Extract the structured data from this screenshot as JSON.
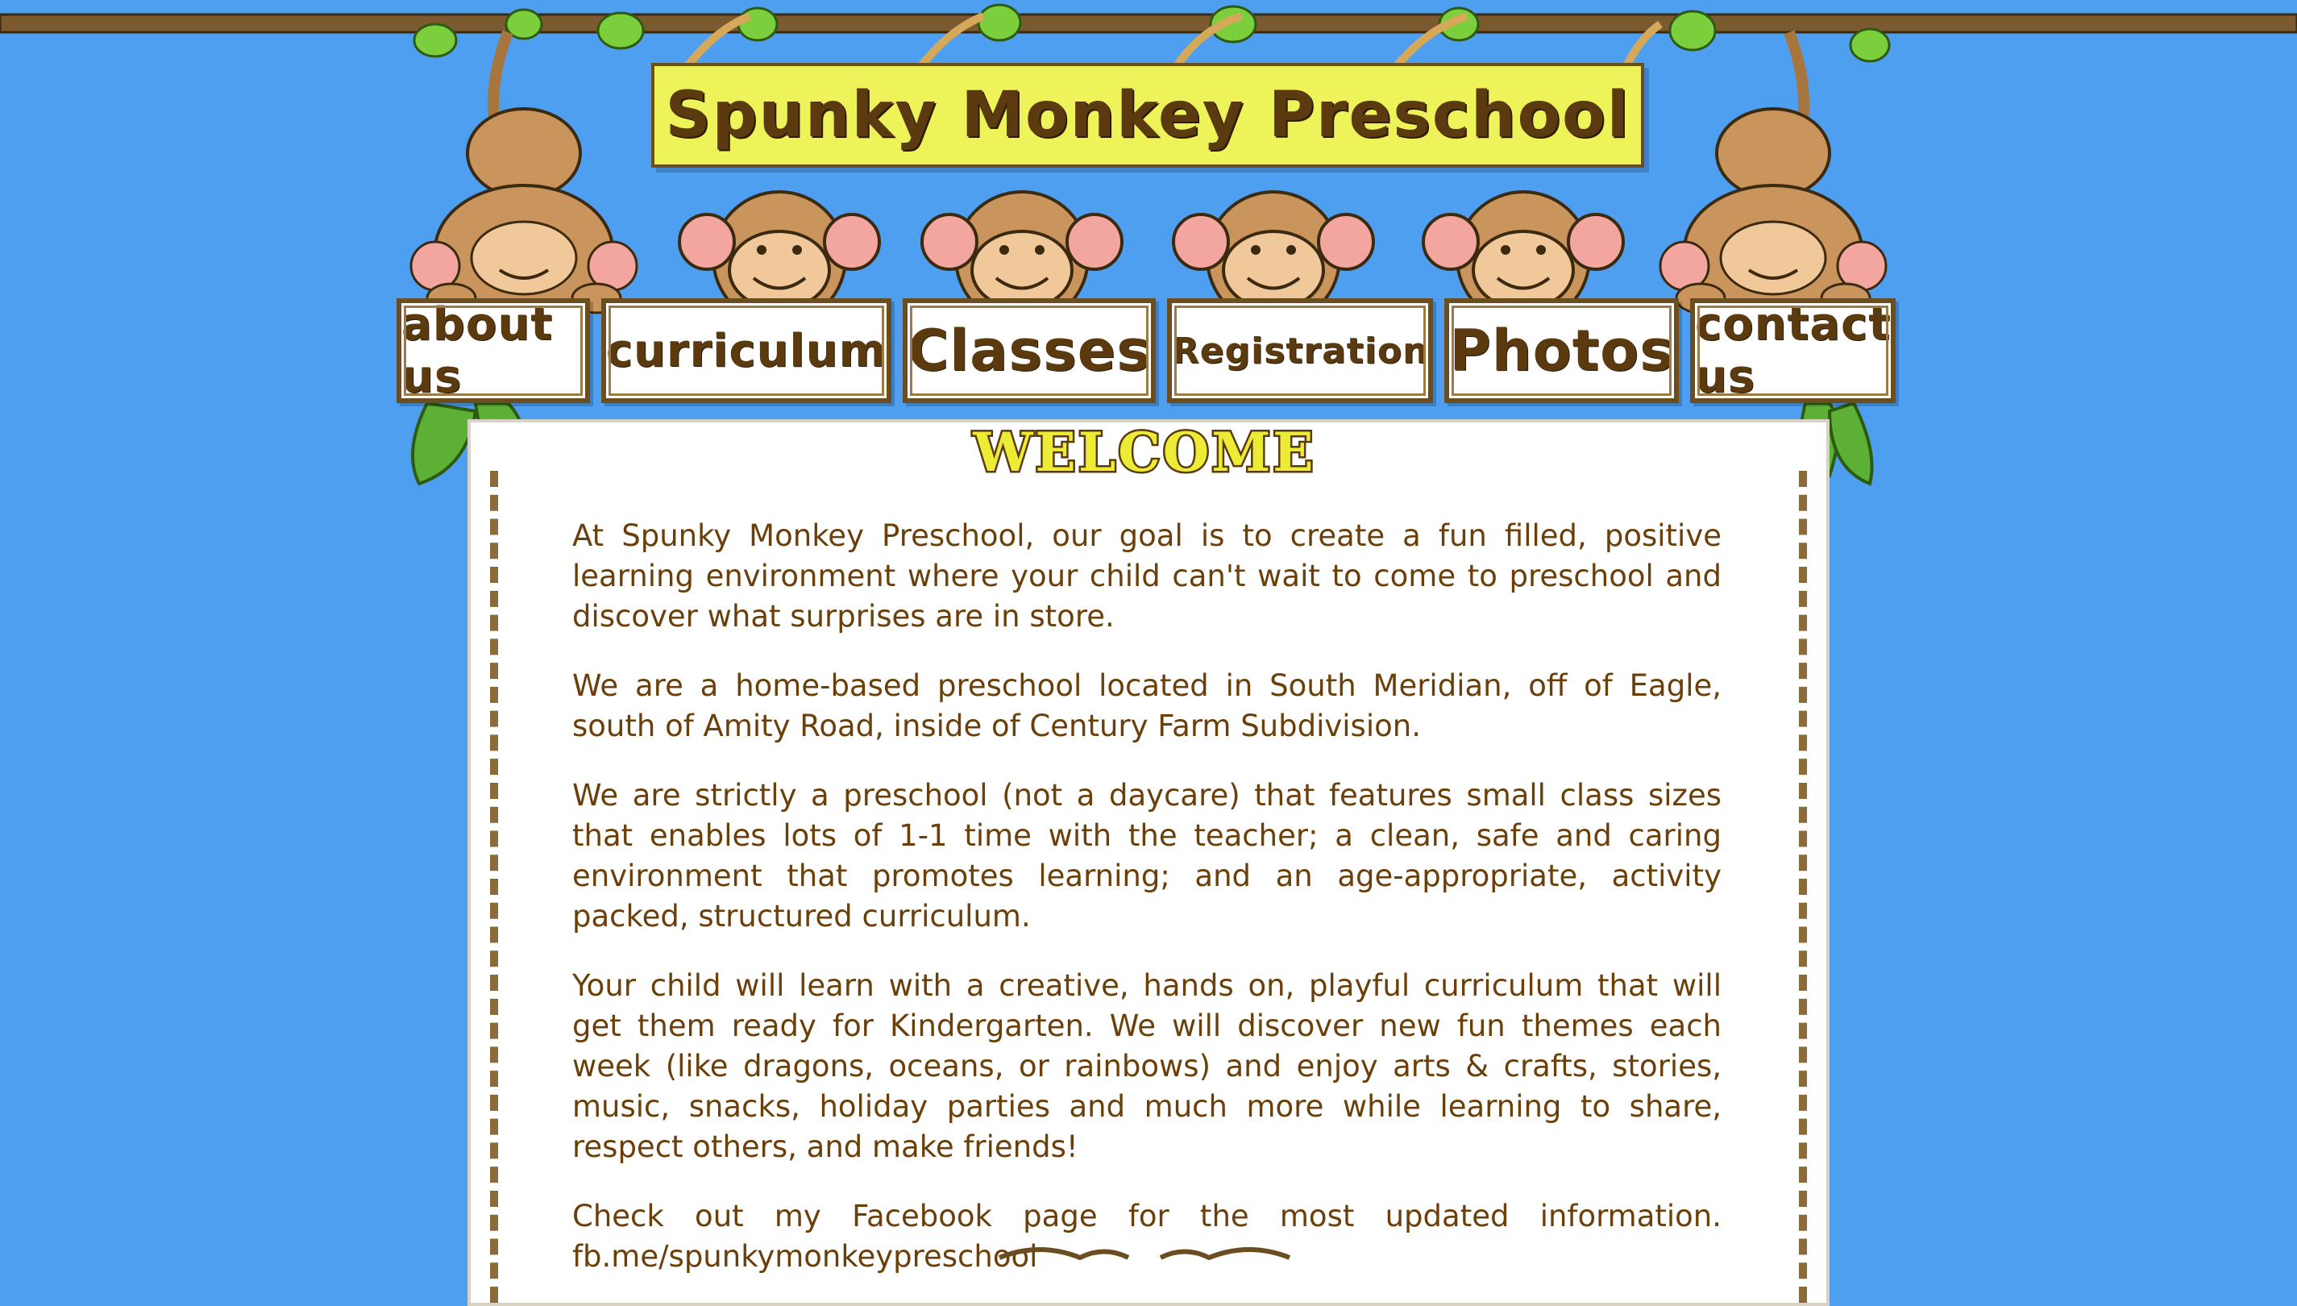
{
  "header": {
    "title": "Spunky Monkey Preschool"
  },
  "nav": {
    "items": [
      {
        "label": "about us"
      },
      {
        "label": "curriculum"
      },
      {
        "label": "Classes"
      },
      {
        "label": "Registration"
      },
      {
        "label": "Photos"
      },
      {
        "label": "contact us"
      }
    ]
  },
  "main": {
    "heading": "WELCOME",
    "paragraphs": [
      "At Spunky Monkey Preschool, our goal is to create a fun filled, positive learning environment where your child can't wait to come to preschool and discover what surprises are in store.",
      "We are a home-based preschool located in South Meridian, off of Eagle, south of Amity Road, inside of Century Farm Subdivision.",
      "We are strictly a preschool (not a daycare) that features small class sizes that enables lots of 1-1 time with the teacher; a clean, safe and caring environment that promotes learning; and an age-appropriate, activity packed, structured curriculum.",
      "Your child will learn with a creative, hands on, playful curriculum that will get them ready for Kindergarten. We will discover new fun themes each week (like dragons, oceans, or rainbows) and enjoy arts & crafts, stories, music, snacks, holiday parties and much more while learning to share, respect others, and make friends!"
    ],
    "facebook_text": "Check out my Facebook page for the most updated information.",
    "facebook_link": "fb.me/spunkymonkeypreschool"
  },
  "colors": {
    "background": "#4f9ff0",
    "text": "#6b3f0a",
    "sign": "#eef35a",
    "frame": "#6b4d1f"
  }
}
